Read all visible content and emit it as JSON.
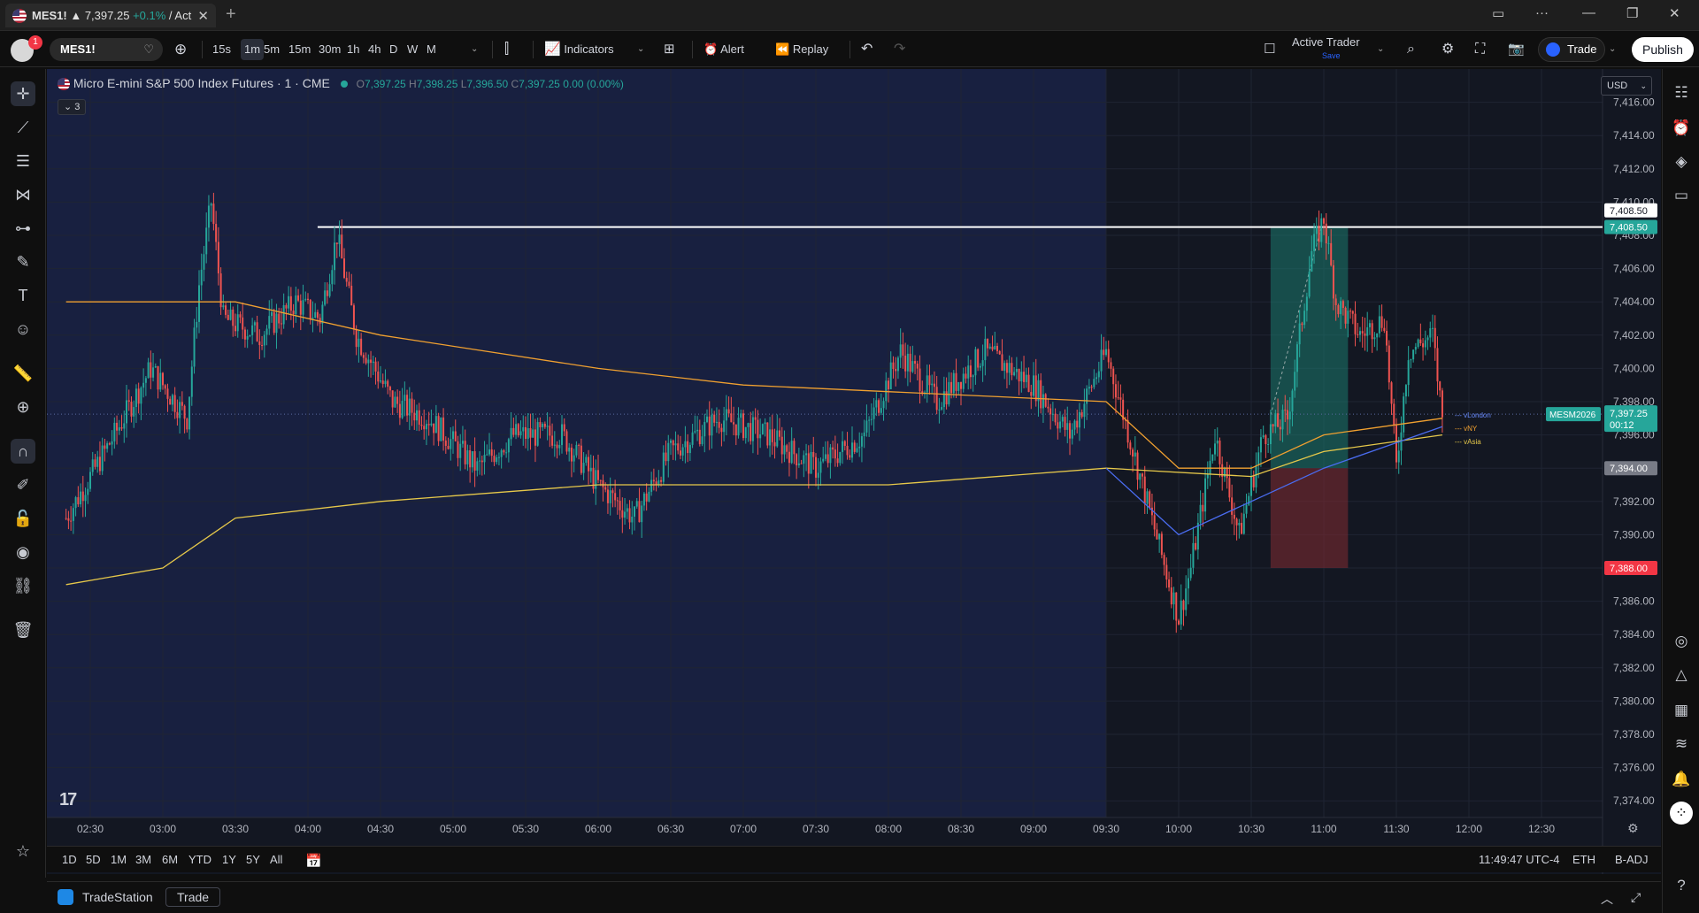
{
  "tab": {
    "symbol": "MES1!",
    "price": "7,397.25",
    "change": "+0.1%",
    "suffix": "/ Acti"
  },
  "toolbar": {
    "symbol": "MES1!",
    "intervals": [
      "15s",
      "1m",
      "5m",
      "15m",
      "30m",
      "1h",
      "4h",
      "D",
      "W",
      "M"
    ],
    "active_interval": "1m",
    "indicators_label": "Indicators",
    "alert_label": "Alert",
    "replay_label": "Replay",
    "active_trader_label": "Active Trader",
    "active_trader_sub": "Save",
    "trade_label": "Trade",
    "publish_label": "Publish",
    "notification_count": "1"
  },
  "legend": {
    "title": "Micro E-mini S&P 500 Index Futures · 1 · CME",
    "open": "7,397.25",
    "high": "7,398.25",
    "low": "7,396.50",
    "close": "7,397.25",
    "change": "0.00 (0.00%)",
    "collapsed_count": "3"
  },
  "currency": "USD",
  "price_labels": {
    "level_top": "7,408.50",
    "level_line": "7,408.50",
    "symbol_tag": "MESM2026",
    "last_price": "7,397.25",
    "countdown": "00:12",
    "entry": "7,394.00",
    "stop": "7,388.00",
    "vlondon": "vLondon",
    "vny": "vNY",
    "vasia": "vAsia"
  },
  "range_buttons": [
    "1D",
    "5D",
    "1M",
    "3M",
    "6M",
    "YTD",
    "1Y",
    "5Y",
    "All"
  ],
  "status": {
    "time": "11:49:47 UTC-4",
    "session": "ETH",
    "adjust": "B-ADJ",
    "broker": "TradeStation",
    "trade_button": "Trade"
  },
  "colors": {
    "background": "#131722",
    "up": "#26a69a",
    "down": "#ef5350",
    "vwap_orange": "#f0a030",
    "vwap_yellow": "#e6c84a",
    "vwap_blue": "#4a6cf0",
    "target_zone": "#1b7a6e",
    "stop_zone": "#7a2a30"
  },
  "chart_data": {
    "type": "candlestick",
    "interval": "1m",
    "x_ticks": [
      "02:30",
      "03:00",
      "03:30",
      "04:00",
      "04:30",
      "05:00",
      "05:30",
      "06:00",
      "06:30",
      "07:00",
      "07:30",
      "08:00",
      "08:30",
      "09:00",
      "09:30",
      "10:00",
      "10:30",
      "11:00",
      "11:30",
      "12:00",
      "12:30"
    ],
    "y_ticks": [
      "7,416.00",
      "7,414.00",
      "7,412.00",
      "7,410.00",
      "7,408.00",
      "7,406.00",
      "7,404.00",
      "7,402.00",
      "7,400.00",
      "7,398.00",
      "7,396.00",
      "7,394.00",
      "7,392.00",
      "7,390.00",
      "7,388.00",
      "7,386.00",
      "7,384.00",
      "7,382.00",
      "7,380.00",
      "7,378.00",
      "7,376.00",
      "7,374.00"
    ],
    "ylim": [
      7373,
      7418
    ],
    "price_path": [
      [
        "02:20",
        7391
      ],
      [
        "02:40",
        7396
      ],
      [
        "02:55",
        7400
      ],
      [
        "03:10",
        7397
      ],
      [
        "03:15",
        7405
      ],
      [
        "03:20",
        7410
      ],
      [
        "03:25",
        7403
      ],
      [
        "03:40",
        7402
      ],
      [
        "03:55",
        7404
      ],
      [
        "04:05",
        7403
      ],
      [
        "04:12",
        7408
      ],
      [
        "04:20",
        7402
      ],
      [
        "04:35",
        7398
      ],
      [
        "04:50",
        7397
      ],
      [
        "05:10",
        7394
      ],
      [
        "05:25",
        7396
      ],
      [
        "05:45",
        7396
      ],
      [
        "06:00",
        7393
      ],
      [
        "06:15",
        7391
      ],
      [
        "06:30",
        7395
      ],
      [
        "06:50",
        7397
      ],
      [
        "07:10",
        7396
      ],
      [
        "07:30",
        7394
      ],
      [
        "07:50",
        7396
      ],
      [
        "08:05",
        7401
      ],
      [
        "08:20",
        7398
      ],
      [
        "08:40",
        7401
      ],
      [
        "09:00",
        7399
      ],
      [
        "09:15",
        7396
      ],
      [
        "09:30",
        7401
      ],
      [
        "09:45",
        7393
      ],
      [
        "10:00",
        7385
      ],
      [
        "10:05",
        7388
      ],
      [
        "10:15",
        7396
      ],
      [
        "10:25",
        7390
      ],
      [
        "10:35",
        7396
      ],
      [
        "10:45",
        7397
      ],
      [
        "10:55",
        7407
      ],
      [
        "11:00",
        7409
      ],
      [
        "11:05",
        7404
      ],
      [
        "11:15",
        7402
      ],
      [
        "11:25",
        7403
      ],
      [
        "11:30",
        7394
      ],
      [
        "11:35",
        7401
      ],
      [
        "11:45",
        7402
      ],
      [
        "11:49",
        7397
      ]
    ],
    "horizontal_line": 7408.5,
    "vwap_orange": [
      [
        "02:20",
        7404
      ],
      [
        "03:30",
        7404
      ],
      [
        "04:30",
        7402
      ],
      [
        "06:00",
        7400
      ],
      [
        "07:00",
        7399
      ],
      [
        "09:30",
        7398
      ],
      [
        "10:00",
        7394
      ],
      [
        "10:30",
        7394
      ],
      [
        "11:00",
        7396
      ],
      [
        "11:49",
        7397
      ]
    ],
    "vwap_yellow": [
      [
        "02:20",
        7387
      ],
      [
        "03:00",
        7388
      ],
      [
        "03:30",
        7391
      ],
      [
        "04:30",
        7392
      ],
      [
        "06:00",
        7393
      ],
      [
        "08:00",
        7393
      ],
      [
        "09:30",
        7394
      ],
      [
        "10:30",
        7393.5
      ],
      [
        "11:00",
        7395
      ],
      [
        "11:49",
        7396
      ]
    ],
    "vwap_blue": [
      [
        "09:30",
        7394
      ],
      [
        "10:00",
        7390
      ],
      [
        "10:30",
        7392
      ],
      [
        "11:00",
        7394
      ],
      [
        "11:49",
        7396.5
      ]
    ],
    "position": {
      "start": "10:38",
      "end": "11:10",
      "entry": 7394,
      "target": 7408.5,
      "stop": 7388
    },
    "session_start": "09:30"
  }
}
